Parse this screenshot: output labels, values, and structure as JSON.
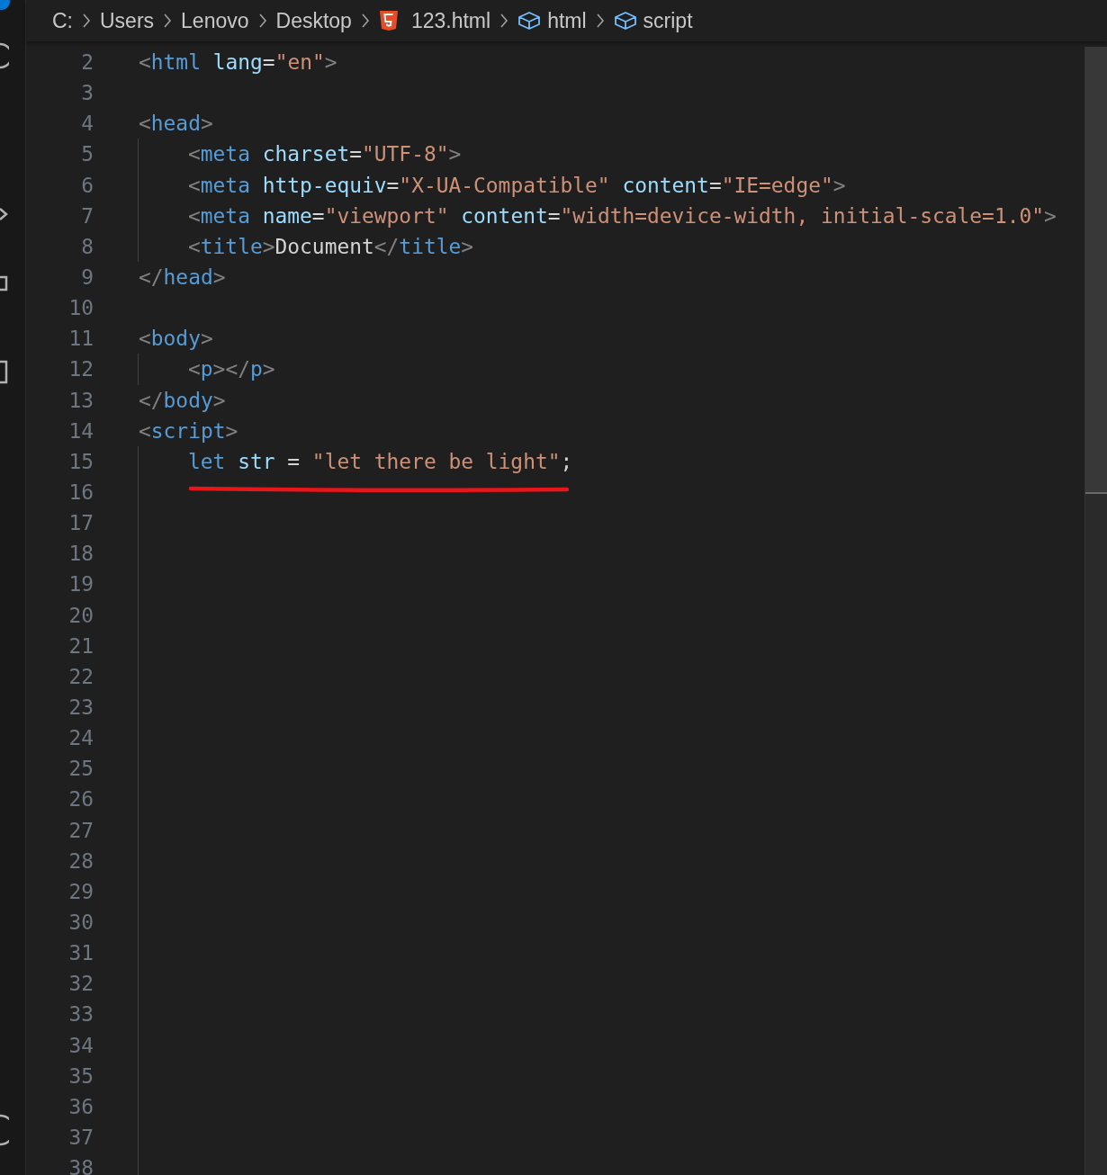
{
  "breadcrumbs": [
    {
      "label": "C:",
      "kind": "folder"
    },
    {
      "label": "Users",
      "kind": "folder"
    },
    {
      "label": "Lenovo",
      "kind": "folder"
    },
    {
      "label": "Desktop",
      "kind": "folder"
    },
    {
      "label": "123.html",
      "kind": "html-file"
    },
    {
      "label": "html",
      "kind": "symbol"
    },
    {
      "label": "script",
      "kind": "symbol"
    }
  ],
  "lines": [
    {
      "number": "2",
      "indented": false,
      "tokens": [
        {
          "text": "<",
          "kind": "bracket"
        },
        {
          "text": "html",
          "kind": "tag"
        },
        {
          "text": " lang",
          "kind": "attr"
        },
        {
          "text": "=",
          "kind": "text"
        },
        {
          "text": "\"en\"",
          "kind": "string"
        },
        {
          "text": ">",
          "kind": "bracket"
        }
      ]
    },
    {
      "number": "3",
      "indented": false
    },
    {
      "number": "4",
      "indented": false,
      "tokens": [
        {
          "text": "<",
          "kind": "bracket"
        },
        {
          "text": "head",
          "kind": "tag"
        },
        {
          "text": ">",
          "kind": "bracket"
        }
      ]
    },
    {
      "number": "5",
      "indented": true,
      "tokens": [
        {
          "text": "<",
          "kind": "bracket"
        },
        {
          "text": "meta",
          "kind": "tag"
        },
        {
          "text": " charset",
          "kind": "attr"
        },
        {
          "text": "=",
          "kind": "text"
        },
        {
          "text": "\"UTF-8\"",
          "kind": "string"
        },
        {
          "text": ">",
          "kind": "bracket"
        }
      ]
    },
    {
      "number": "6",
      "indented": true,
      "tokens": [
        {
          "text": "<",
          "kind": "bracket"
        },
        {
          "text": "meta",
          "kind": "tag"
        },
        {
          "text": " http-equiv",
          "kind": "attr"
        },
        {
          "text": "=",
          "kind": "text"
        },
        {
          "text": "\"X-UA-Compatible\"",
          "kind": "string"
        },
        {
          "text": " content",
          "kind": "attr"
        },
        {
          "text": "=",
          "kind": "text"
        },
        {
          "text": "\"IE=edge\"",
          "kind": "string"
        },
        {
          "text": ">",
          "kind": "bracket"
        }
      ]
    },
    {
      "number": "7",
      "indented": true,
      "tokens": [
        {
          "text": "<",
          "kind": "bracket"
        },
        {
          "text": "meta",
          "kind": "tag"
        },
        {
          "text": " name",
          "kind": "attr"
        },
        {
          "text": "=",
          "kind": "text"
        },
        {
          "text": "\"viewport\"",
          "kind": "string"
        },
        {
          "text": " content",
          "kind": "attr"
        },
        {
          "text": "=",
          "kind": "text"
        },
        {
          "text": "\"width=device-width, initial-scale=1.0\"",
          "kind": "string"
        },
        {
          "text": ">",
          "kind": "bracket"
        }
      ]
    },
    {
      "number": "8",
      "indented": true,
      "tokens": [
        {
          "text": "<",
          "kind": "bracket"
        },
        {
          "text": "title",
          "kind": "tag"
        },
        {
          "text": ">",
          "kind": "bracket"
        },
        {
          "text": "Document",
          "kind": "text"
        },
        {
          "text": "</",
          "kind": "bracket"
        },
        {
          "text": "title",
          "kind": "tag"
        },
        {
          "text": ">",
          "kind": "bracket"
        }
      ]
    },
    {
      "number": "9",
      "indented": false,
      "tokens": [
        {
          "text": "</",
          "kind": "bracket"
        },
        {
          "text": "head",
          "kind": "tag"
        },
        {
          "text": ">",
          "kind": "bracket"
        }
      ]
    },
    {
      "number": "10",
      "indented": false
    },
    {
      "number": "11",
      "indented": false,
      "tokens": [
        {
          "text": "<",
          "kind": "bracket"
        },
        {
          "text": "body",
          "kind": "tag"
        },
        {
          "text": ">",
          "kind": "bracket"
        }
      ]
    },
    {
      "number": "12",
      "indented": true,
      "tokens": [
        {
          "text": "<",
          "kind": "bracket"
        },
        {
          "text": "p",
          "kind": "tag"
        },
        {
          "text": "></",
          "kind": "bracket"
        },
        {
          "text": "p",
          "kind": "tag"
        },
        {
          "text": ">",
          "kind": "bracket"
        }
      ]
    },
    {
      "number": "13",
      "indented": false,
      "tokens": [
        {
          "text": "</",
          "kind": "bracket"
        },
        {
          "text": "body",
          "kind": "tag"
        },
        {
          "text": ">",
          "kind": "bracket"
        }
      ]
    },
    {
      "number": "14",
      "indented": false,
      "tokens": [
        {
          "text": "<",
          "kind": "bracket"
        },
        {
          "text": "script",
          "kind": "tag"
        },
        {
          "text": ">",
          "kind": "bracket"
        }
      ]
    },
    {
      "number": "15",
      "indented": true,
      "tokens": [
        {
          "text": "let",
          "kind": "keyword"
        },
        {
          "text": " str",
          "kind": "variable"
        },
        {
          "text": " =",
          "kind": "text"
        },
        {
          "text": " \"let there be light\"",
          "kind": "string"
        },
        {
          "text": ";",
          "kind": "text"
        }
      ]
    },
    {
      "number": "16",
      "indented": true
    },
    {
      "number": "17",
      "indented": true
    },
    {
      "number": "18",
      "indented": true
    },
    {
      "number": "19",
      "indented": true
    },
    {
      "number": "20",
      "indented": true
    },
    {
      "number": "21",
      "indented": true
    },
    {
      "number": "22",
      "indented": true
    },
    {
      "number": "23",
      "indented": true
    },
    {
      "number": "24",
      "indented": true
    },
    {
      "number": "25",
      "indented": true
    },
    {
      "number": "26",
      "indented": true
    },
    {
      "number": "27",
      "indented": true
    },
    {
      "number": "28",
      "indented": true
    },
    {
      "number": "29",
      "indented": true
    },
    {
      "number": "30",
      "indented": true
    },
    {
      "number": "31",
      "indented": true
    },
    {
      "number": "32",
      "indented": true
    },
    {
      "number": "33",
      "indented": true
    },
    {
      "number": "34",
      "indented": true
    },
    {
      "number": "35",
      "indented": true
    },
    {
      "number": "36",
      "indented": true
    },
    {
      "number": "37",
      "indented": true
    },
    {
      "number": "38",
      "indented": true
    }
  ]
}
